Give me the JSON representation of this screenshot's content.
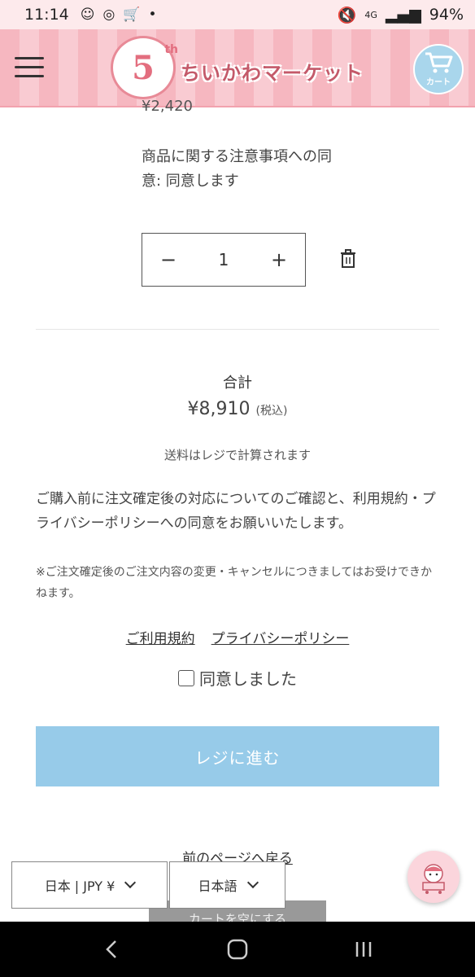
{
  "status_bar": {
    "time": "11:14",
    "battery": "94%",
    "network": "4G"
  },
  "header": {
    "logo_text": "ちいかわマーケット",
    "logo_number": "5",
    "logo_suffix": "th",
    "cart_label": "カート"
  },
  "item": {
    "price": "¥2,420",
    "notice": "商品に関する注意事項への同意: 同意します",
    "quantity": "1"
  },
  "summary": {
    "total_label": "合計",
    "total_value": "¥8,910",
    "tax_note": "(税込)",
    "shipping_note": "送料はレジで計算されます",
    "agree_text": "ご購入前に注文確定後の対応についてのご確認と、利用規約・プライバシーポリシーへの同意をお願いいたします。",
    "cancel_note": "※ご注文確定後のご注文内容の変更・キャンセルにつきましてはお受けできかねます。",
    "terms_link": "ご利用規約",
    "privacy_link": "プライバシーポリシー",
    "checkbox_label": "同意しました",
    "checkout_button": "レジに進む",
    "back_link": "前のページへ戻る",
    "empty_cart_button": "カートを空にする"
  },
  "selectors": {
    "country": "日本 | JPY ¥",
    "language": "日本語"
  },
  "colors": {
    "header_pink": "#f6b7c0",
    "checkout_blue": "#97cbe9",
    "cart_blue": "#a9d6ec"
  }
}
